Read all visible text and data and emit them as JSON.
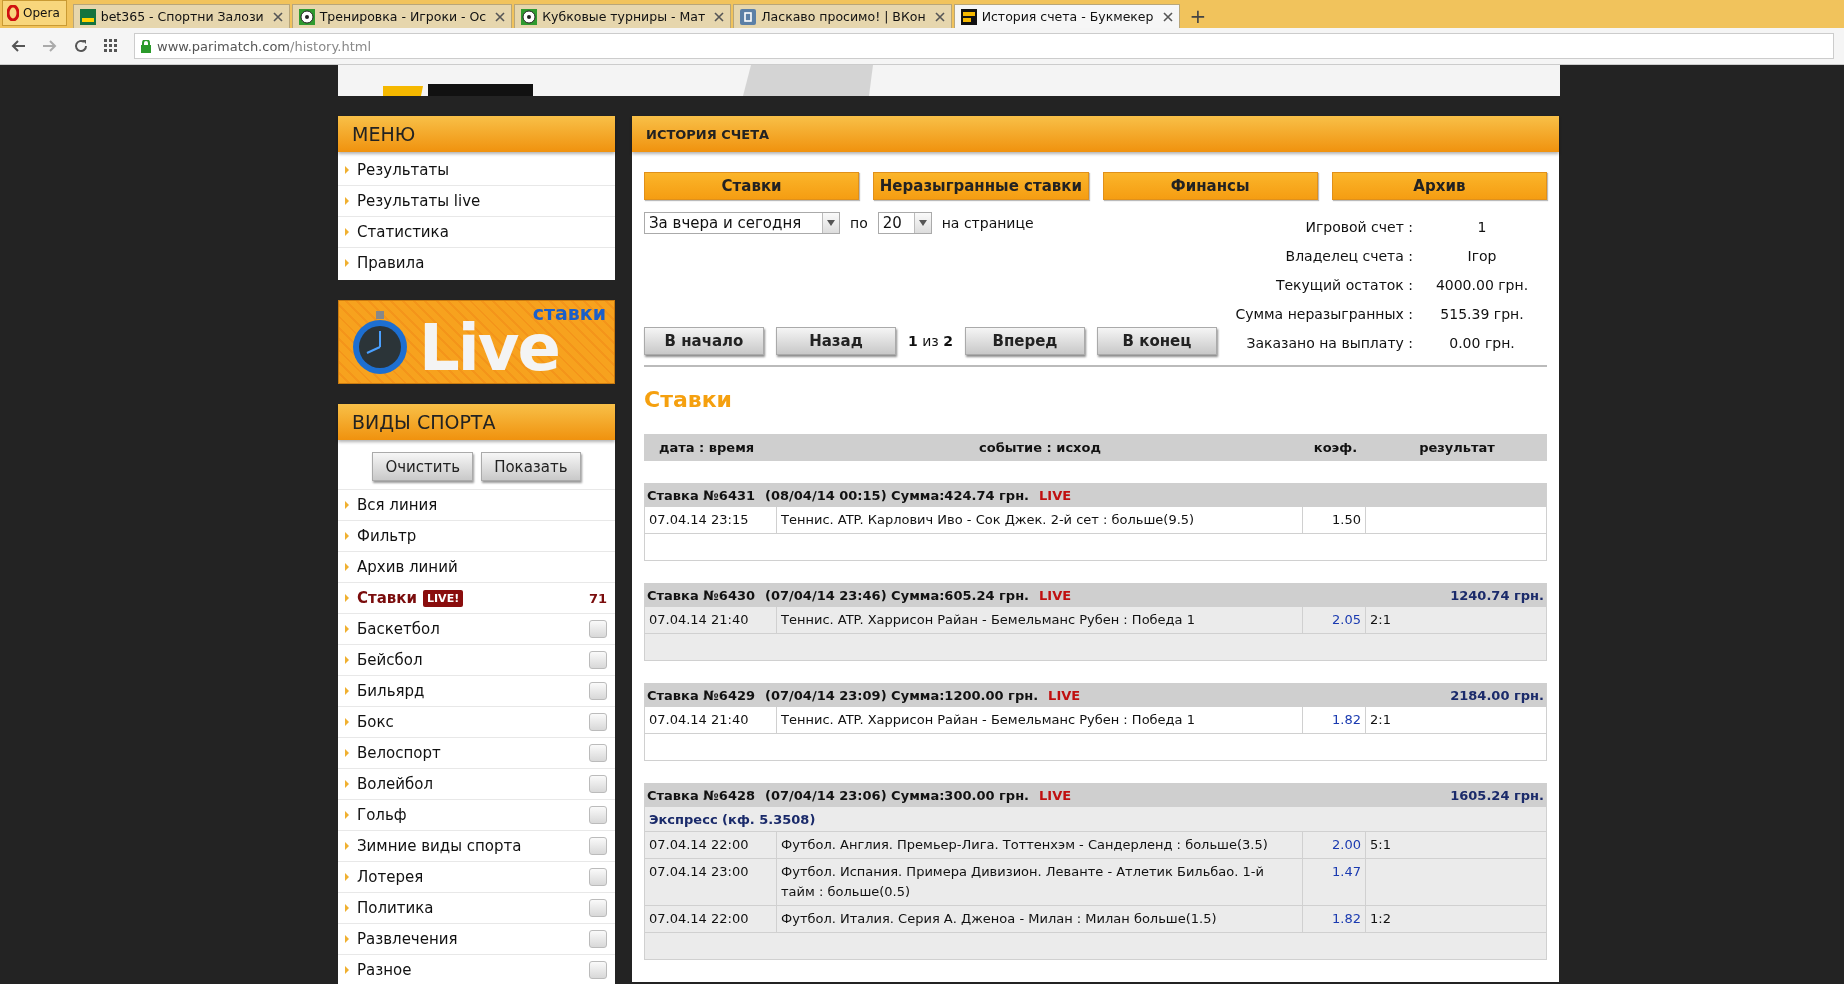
{
  "browser": {
    "menu_button": "Opera",
    "tabs": [
      {
        "title": "bet365 - Спортни Залози",
        "selected": false
      },
      {
        "title": "Тренировка - Игроки - Ос",
        "selected": false
      },
      {
        "title": "Кубковые турниры - Мат",
        "selected": false
      },
      {
        "title": "Ласкаво просимо! | ВКон",
        "selected": false
      },
      {
        "title": "История счета - Букмекер",
        "selected": true
      }
    ],
    "new_tab": "+",
    "url_host": "www.parimatch.com",
    "url_path": "/history.html"
  },
  "menu": {
    "title": "МЕНЮ",
    "items": [
      "Результаты",
      "Результаты live",
      "Статистика",
      "Правила"
    ]
  },
  "live_banner": {
    "caption": "ставки",
    "word": "Live"
  },
  "sports": {
    "title": "ВИДЫ СПОРТА",
    "buttons": [
      "Очистить",
      "Показать"
    ],
    "items": [
      {
        "kind": "link",
        "label": "Вся линия"
      },
      {
        "kind": "link",
        "label": "Фильтр"
      },
      {
        "kind": "link",
        "label": "Архив линий"
      },
      {
        "kind": "live",
        "label": "Ставки",
        "badge": "LIVE!",
        "count": "71"
      },
      {
        "kind": "sport",
        "label": "Баскетбол",
        "checked": false
      },
      {
        "kind": "sport",
        "label": "Бейсбол",
        "checked": false
      },
      {
        "kind": "sport",
        "label": "Бильярд",
        "checked": false
      },
      {
        "kind": "sport",
        "label": "Бокс",
        "checked": false
      },
      {
        "kind": "sport",
        "label": "Велоспорт",
        "checked": false
      },
      {
        "kind": "sport",
        "label": "Волейбол",
        "checked": false
      },
      {
        "kind": "sport",
        "label": "Гольф",
        "checked": false
      },
      {
        "kind": "sport",
        "label": "Зимние виды спорта",
        "checked": false
      },
      {
        "kind": "sport",
        "label": "Лотерея",
        "checked": false
      },
      {
        "kind": "sport",
        "label": "Политика",
        "checked": false
      },
      {
        "kind": "sport",
        "label": "Развлечения",
        "checked": false
      },
      {
        "kind": "sport",
        "label": "Разное",
        "checked": false
      }
    ]
  },
  "history": {
    "title": "ИСТОРИЯ СЧЕТА",
    "tabs": [
      "Ставки",
      "Неразыгранные ставки",
      "Финансы",
      "Архив"
    ],
    "period": "За вчера и сегодня",
    "per_label": "по",
    "per_page": "20",
    "per_suffix": "на странице",
    "account": [
      {
        "label": "Игровой счет :",
        "value": "1"
      },
      {
        "label": "Владелец счета :",
        "value": "Iгор"
      },
      {
        "label": "Текущий остаток :",
        "value": "4000.00 грн."
      },
      {
        "label": "Сумма неразыгранных :",
        "value": "515.39 грн."
      },
      {
        "label": "Заказано на выплату :",
        "value": "0.00 грн."
      }
    ],
    "nav": [
      "В начало",
      "Назад",
      "Вперед",
      "В конец"
    ],
    "page_info": "**1** из **2**",
    "section_title": "Ставки",
    "columns": [
      "дата : время",
      "событие : исход",
      "коэф.",
      "результат"
    ],
    "bets": [
      {
        "title": "Ставка №6431",
        "detail": "(08/04/14 00:15) Сумма:424.74 грн.",
        "live": "LIVE",
        "settled": false,
        "rows": [
          {
            "date": "07.04.14 23:15",
            "event": "Теннис. ATP. Карлович Иво - Сок Джек. 2-й сет : больше(9.5)",
            "coef": "1.50"
          }
        ]
      },
      {
        "title": "Ставка №6430",
        "detail": "(07/04/14 23:46) Сумма:605.24 грн.",
        "live": "LIVE",
        "payout": "1240.74 грн.",
        "settled": true,
        "rows": [
          {
            "date": "07.04.14 21:40",
            "event": "Теннис. ATP. Харрисон Райан - Бемельманс Рубен : Победа 1",
            "coef": "2.05",
            "result": "2:1"
          }
        ]
      },
      {
        "title": "Ставка №6429",
        "detail": "(07/04/14 23:09) Сумма:1200.00 грн.",
        "live": "LIVE",
        "payout": "2184.00 грн.",
        "settled": true,
        "rows": [
          {
            "date": "07.04.14 21:40",
            "event": "Теннис. ATP. Харрисон Райан - Бемельманс Рубен : Победа 1",
            "coef": "1.82",
            "result": "2:1"
          }
        ]
      },
      {
        "title": "Ставка №6428",
        "detail": "(07/04/14 23:06) Сумма:300.00 грн.",
        "live": "LIVE",
        "payout": "1605.24 грн.",
        "settled": true,
        "express": "Экспресс (кф. 5.3508)",
        "rows": [
          {
            "date": "07.04.14 22:00",
            "event": "Футбол. Англия. Премьер-Лига. Тоттенхэм - Сандерленд : больше(3.5)",
            "coef": "2.00",
            "result": "5:1"
          },
          {
            "date": "07.04.14 23:00",
            "event": "Футбол. Испания. Примера Дивизион. Леванте - Атлетик Бильбао. 1-й тайм : больше(0.5)",
            "coef": "1.47"
          },
          {
            "date": "07.04.14 22:00",
            "event": "Футбол. Италия. Серия А. Дженоа - Милан : Милан больше(1.5)",
            "coef": "1.82",
            "result": "1:2"
          }
        ]
      }
    ]
  }
}
